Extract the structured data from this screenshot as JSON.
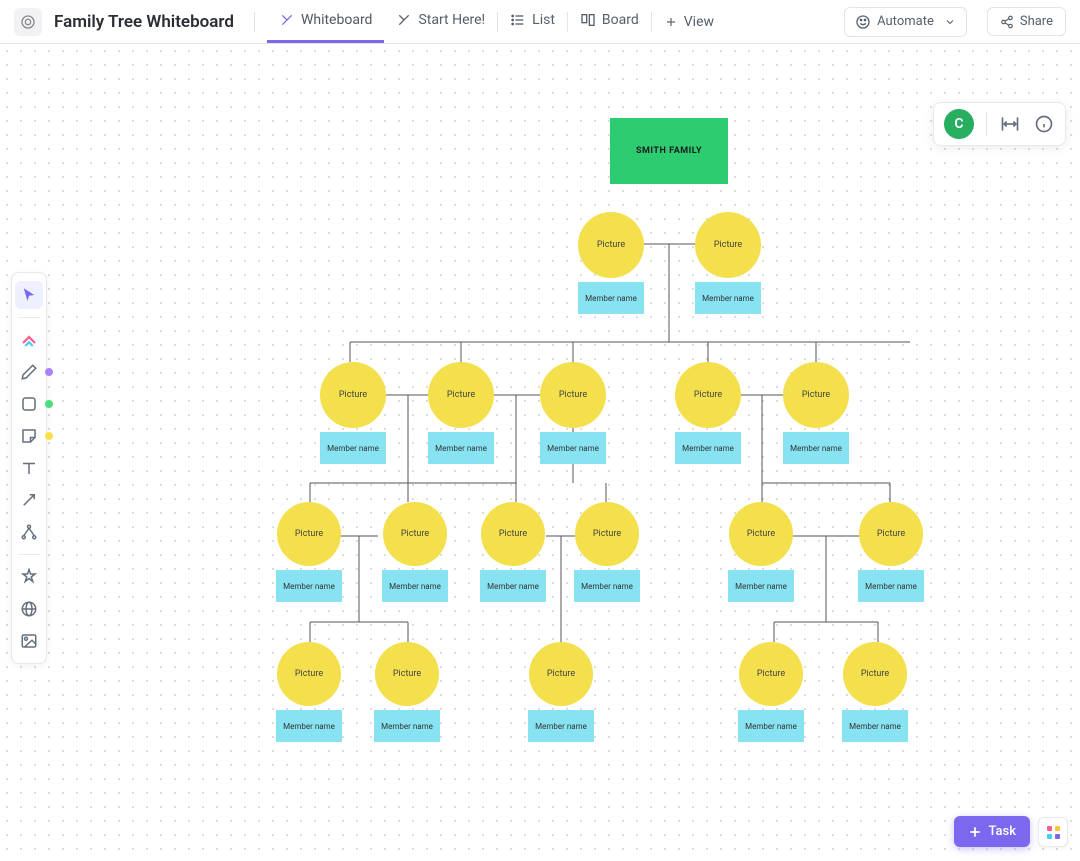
{
  "header": {
    "title": "Family Tree Whiteboard",
    "tabs": [
      {
        "label": "Whiteboard",
        "active": true
      },
      {
        "label": "Start Here!"
      },
      {
        "label": "List"
      },
      {
        "label": "Board"
      }
    ],
    "view_label": "View",
    "automate_label": "Automate",
    "share_label": "Share"
  },
  "float_panel": {
    "avatar_initial": "C"
  },
  "tree": {
    "family_name": "SMITH FAMILY",
    "picture_label": "Picture",
    "member_label": "Member name"
  },
  "colors": {
    "accent": "#7b68ee",
    "green": "#2ecc71",
    "yellow": "#f3e04c",
    "cyan": "#87e3f2",
    "avatar": "#27ae60",
    "dot_purple": "#a881ff",
    "dot_green": "#4ade80",
    "dot_yellow": "#fde047"
  },
  "task_button": "Task"
}
